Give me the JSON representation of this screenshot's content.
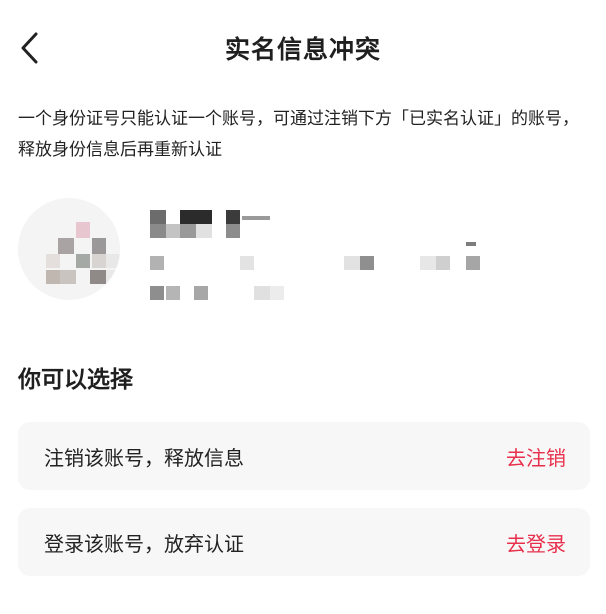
{
  "header": {
    "title": "实名信息冲突",
    "back_icon": "chevron-left-icon"
  },
  "notice": {
    "text": "一个身份证号只能认证一个账号，可通过注销下方「已实名认证」的账号，释放身份信息后再重新认证"
  },
  "account": {
    "avatar_state": "pixelated",
    "info_state": "pixelated"
  },
  "options": {
    "title": "你可以选择",
    "items": [
      {
        "label": "注销该账号，释放信息",
        "action": "去注销"
      },
      {
        "label": "登录该账号，放弃认证",
        "action": "去登录"
      }
    ]
  },
  "colors": {
    "accent": "#e8304c",
    "card_background": "#f7f7f7",
    "text_primary": "#222222"
  }
}
